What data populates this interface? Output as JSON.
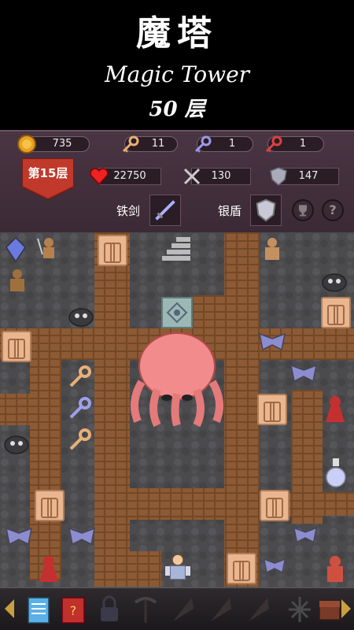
{
  "header": {
    "title": "魔塔",
    "subtitle": "Magic Tower",
    "floor_count": "50 层"
  },
  "resources": {
    "gold": "735",
    "yellow_keys": "11",
    "blue_keys": "1",
    "red_keys": "1"
  },
  "hero": {
    "floor_label": "第15层",
    "hp": "22750",
    "attack": "130",
    "defense": "147",
    "weapon_label": "铁剑",
    "armor_label": "银盾"
  },
  "colors": {
    "panel": "#3b2a35",
    "path": "#8c5a34",
    "stone": "#4a4a4d",
    "floor_badge": "#c0392b"
  },
  "toolbar": {
    "items": [
      "notepad-icon",
      "monster-book-icon",
      "lock-icon",
      "pickaxe-icon",
      "wing-icon",
      "wing-icon",
      "wing-icon",
      "snowflake-icon",
      "treasure-chest-icon"
    ]
  }
}
